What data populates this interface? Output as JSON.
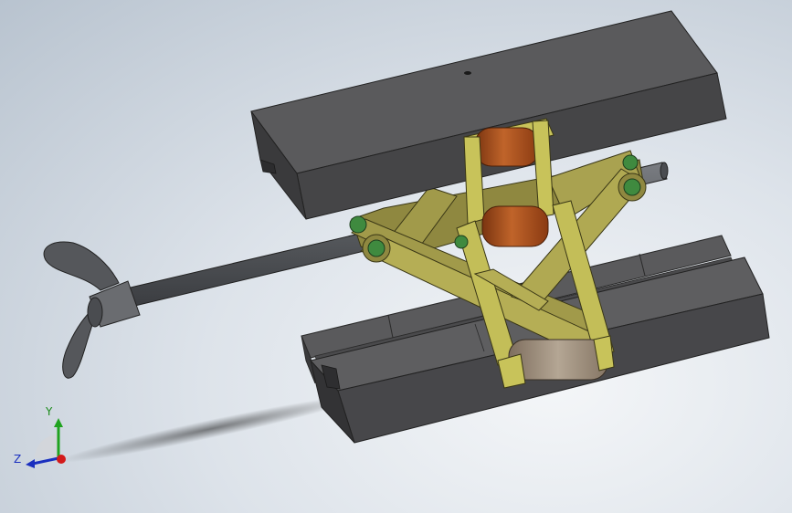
{
  "viewport": {
    "background_top": "#b8c3cf",
    "background_bottom": "#f4f6f8"
  },
  "model": {
    "description_parts": [
      "top-plate",
      "base-plate",
      "scissor-link-left",
      "scissor-link-right",
      "upper-roller",
      "lower-roller",
      "bottom-roller",
      "lead-screw",
      "wing-handle"
    ],
    "colors": {
      "plate_dark": "#4b4b4d",
      "plate_light": "#666668",
      "link_olive": "#a19a4a",
      "link_yellow": "#c8c35a",
      "roller_copper": "#b0541c",
      "roller_tan": "#9c8c7a",
      "pin_green": "#3f8a3f",
      "screw_gray": "#55585c"
    }
  },
  "triad": {
    "y_label": "Y",
    "z_label": "Z",
    "y_color": "#1fa31f",
    "z_color": "#1a2fbf",
    "x_color": "#d31a1a"
  }
}
